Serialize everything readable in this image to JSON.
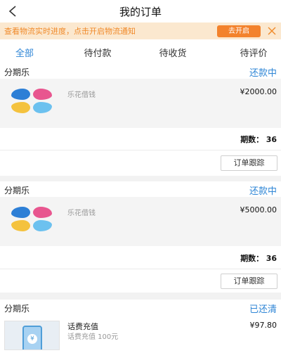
{
  "nav": {
    "title": "我的订单",
    "back_icon": "chevron-left-icon"
  },
  "notice": {
    "text": "查看物流实时进度，点击开启物流通知",
    "button": "去开启",
    "close_icon": "close-icon",
    "accent": "#f3822c"
  },
  "tabs": [
    {
      "label": "全部",
      "active": true
    },
    {
      "label": "待付款",
      "active": false
    },
    {
      "label": "待收货",
      "active": false
    },
    {
      "label": "待评价",
      "active": false
    }
  ],
  "orders": [
    {
      "shop": "分期乐",
      "status": "还款中",
      "product": "乐花借钱",
      "price": "¥2000.00",
      "periods_label": "期数：",
      "periods_value": "36",
      "track_button": "订单跟踪"
    },
    {
      "shop": "分期乐",
      "status": "还款中",
      "product": "乐花借钱",
      "price": "¥5000.00",
      "periods_label": "期数：",
      "periods_value": "36",
      "track_button": "订单跟踪"
    },
    {
      "shop": "分期乐",
      "status": "已还清",
      "product": "话费充值",
      "subtitle": "话费充值 100元",
      "price": "¥97.80"
    }
  ],
  "colors": {
    "brand_blue": "#2f86d6",
    "notice_bg": "#fbe8cf"
  }
}
